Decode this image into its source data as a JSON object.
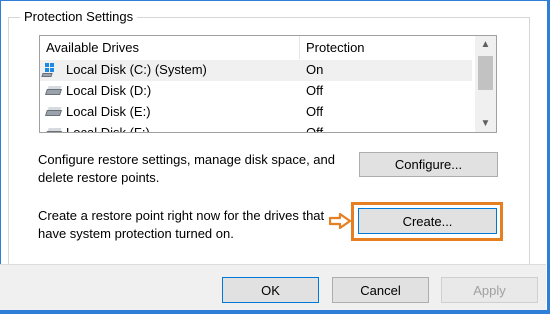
{
  "group": {
    "title": "Protection Settings"
  },
  "drives": {
    "headers": {
      "drive": "Available Drives",
      "protection": "Protection"
    },
    "rows": [
      {
        "name": "Local Disk (C:) (System)",
        "protection": "On",
        "icon": "system-drive-icon",
        "selected": true
      },
      {
        "name": "Local Disk (D:)",
        "protection": "Off",
        "icon": "drive-icon"
      },
      {
        "name": "Local Disk (E:)",
        "protection": "Off",
        "icon": "drive-icon"
      },
      {
        "name": "Local Disk (F:)",
        "protection": "Off",
        "icon": "drive-icon"
      }
    ]
  },
  "configure": {
    "text": "Configure restore settings, manage disk space, and delete restore points.",
    "button": "Configure..."
  },
  "create": {
    "text": "Create a restore point right now for the drives that have system protection turned on.",
    "button": "Create...",
    "highlight_color": "#e67e22"
  },
  "footer": {
    "ok": "OK",
    "cancel": "Cancel",
    "apply": "Apply"
  },
  "colors": {
    "frame": "#2f7fd9",
    "primary_border": "#0078d7"
  }
}
